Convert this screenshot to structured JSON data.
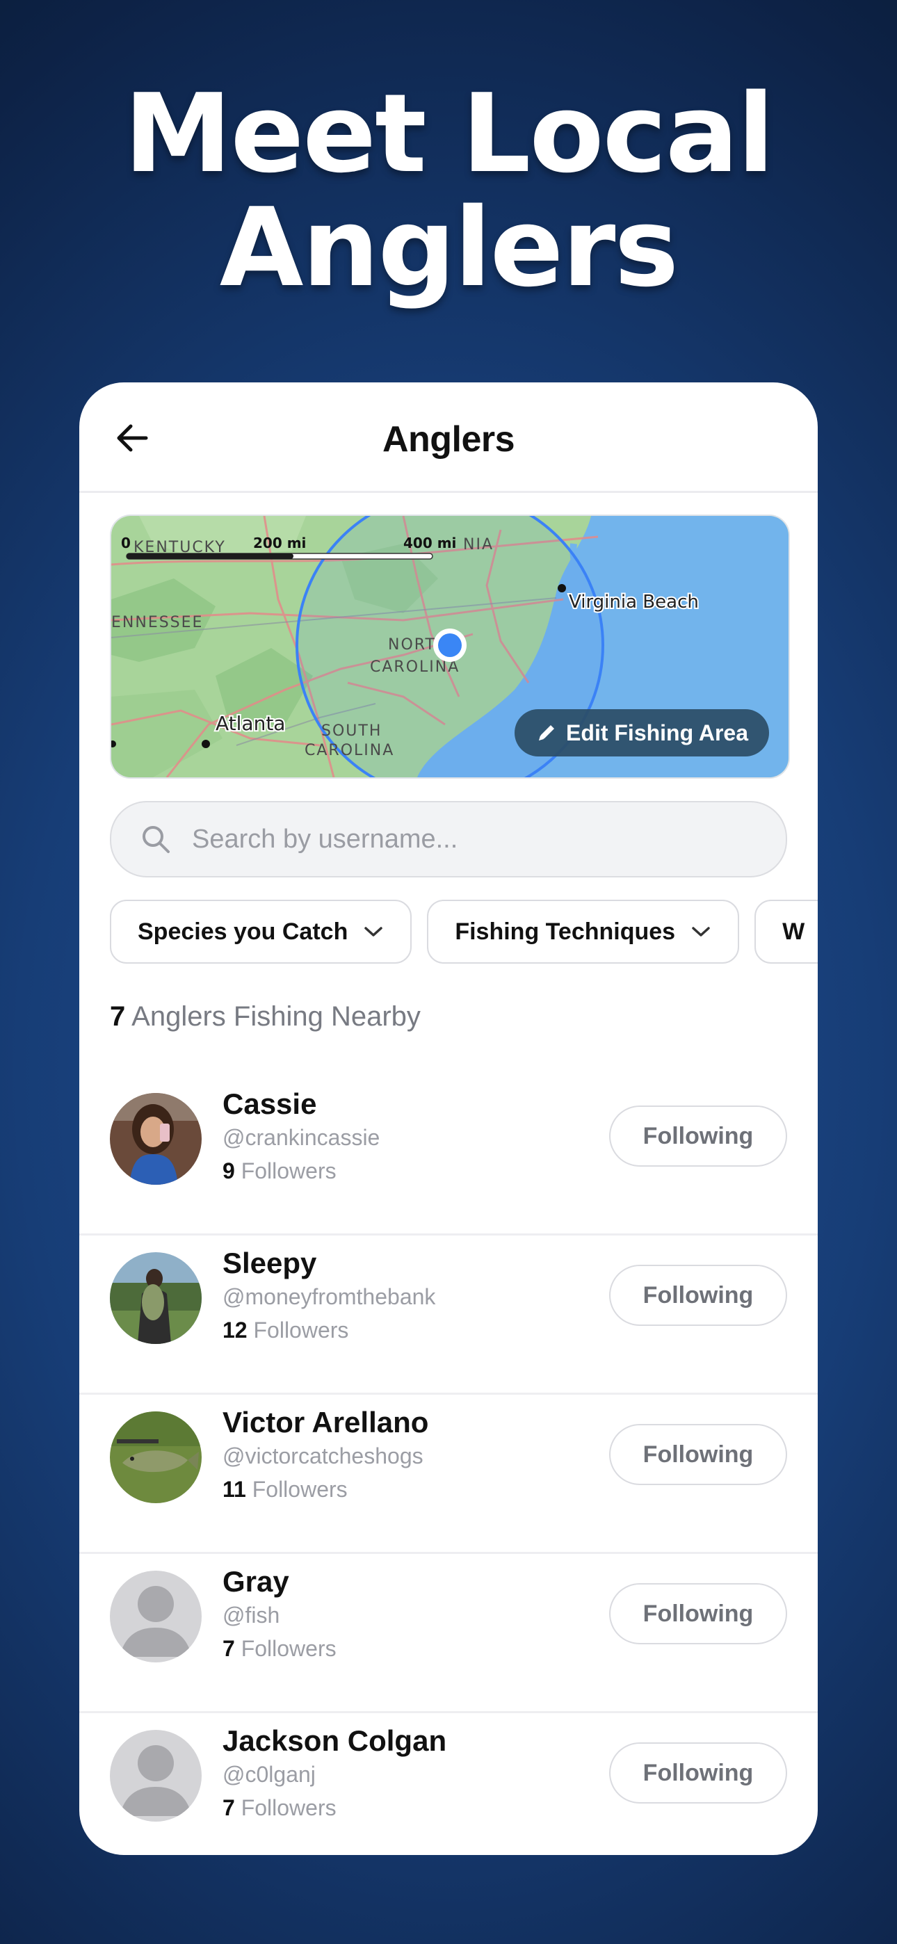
{
  "hero": {
    "line1": "Meet Local",
    "line2": "Anglers"
  },
  "nav": {
    "title": "Anglers",
    "back_icon": "arrow-left-icon"
  },
  "map": {
    "scale_labels": [
      "0",
      "200 mi",
      "400 mi"
    ],
    "place_labels": {
      "kentucky": "KENTUCKY",
      "virginia": "NIA",
      "tennessee": "ENNESSEE",
      "virginia_beach": "Virginia Beach",
      "north_carolina_1": "NORT",
      "north_carolina_2": "CAROLINA",
      "atlanta": "Atlanta",
      "south_carolina_1": "SOUTH",
      "south_carolina_2": "CAROLINA"
    },
    "edit_button": "Edit Fishing Area",
    "land_color": "#a8d49a",
    "water_color": "#72b4ec",
    "radius_color": "#3b82f6"
  },
  "search": {
    "placeholder": "Search by username..."
  },
  "filters": [
    {
      "label": "Species you Catch"
    },
    {
      "label": "Fishing Techniques"
    },
    {
      "label": "W"
    }
  ],
  "results": {
    "count": "7",
    "label": "Anglers Fishing Nearby"
  },
  "anglers": [
    {
      "name": "Cassie",
      "handle": "@crankincassie",
      "followers_count": "9",
      "followers_label": "Followers",
      "button": "Following"
    },
    {
      "name": "Sleepy",
      "handle": "@moneyfromthebank",
      "followers_count": "12",
      "followers_label": "Followers",
      "button": "Following"
    },
    {
      "name": "Victor Arellano",
      "handle": "@victorcatcheshogs",
      "followers_count": "11",
      "followers_label": "Followers",
      "button": "Following"
    },
    {
      "name": "Gray",
      "handle": "@fish",
      "followers_count": "7",
      "followers_label": "Followers",
      "button": "Following"
    },
    {
      "name": "Jackson Colgan",
      "handle": "@c0lganj",
      "followers_count": "7",
      "followers_label": "Followers",
      "button": "Following"
    }
  ]
}
